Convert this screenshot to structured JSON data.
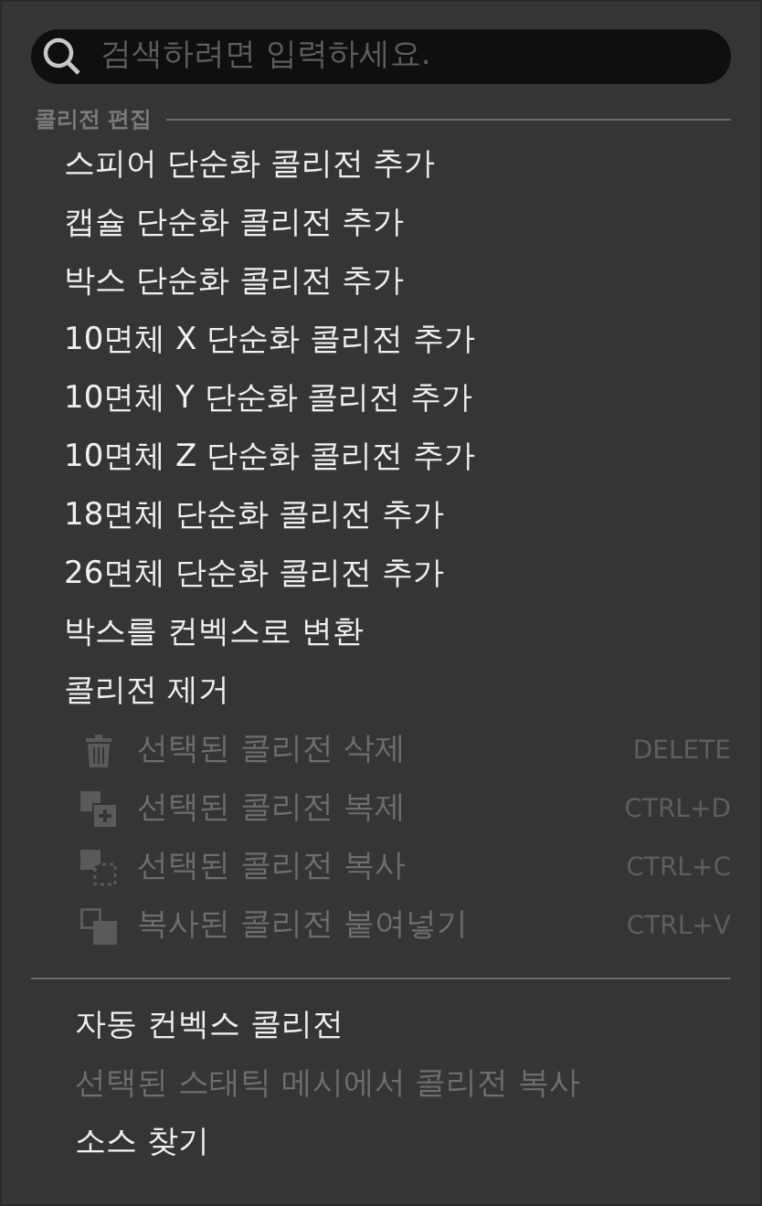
{
  "search": {
    "placeholder": "검색하려면 입력하세요."
  },
  "section": {
    "title": "콜리전 편집"
  },
  "items": [
    {
      "kind": "plain",
      "label": "스피어 단순화 콜리전 추가",
      "disabled": false
    },
    {
      "kind": "plain",
      "label": "캡슐 단순화 콜리전 추가",
      "disabled": false
    },
    {
      "kind": "plain",
      "label": "박스 단순화 콜리전 추가",
      "disabled": false
    },
    {
      "kind": "plain",
      "label": "10면체 X 단순화 콜리전 추가",
      "disabled": false
    },
    {
      "kind": "plain",
      "label": "10면체 Y 단순화 콜리전 추가",
      "disabled": false
    },
    {
      "kind": "plain",
      "label": "10면체 Z 단순화 콜리전 추가",
      "disabled": false
    },
    {
      "kind": "plain",
      "label": "18면체 단순화 콜리전 추가",
      "disabled": false
    },
    {
      "kind": "plain",
      "label": "26면체 단순화 콜리전 추가",
      "disabled": false
    },
    {
      "kind": "plain",
      "label": "박스를 컨벡스로 변환",
      "disabled": false
    },
    {
      "kind": "plain",
      "label": "콜리전 제거",
      "disabled": false
    },
    {
      "kind": "delete",
      "label": "선택된 콜리전 삭제",
      "shortcut": "DELETE",
      "disabled": true
    },
    {
      "kind": "duplicate",
      "label": "선택된 콜리전 복제",
      "shortcut": "CTRL+D",
      "disabled": true
    },
    {
      "kind": "copy",
      "label": "선택된 콜리전 복사",
      "shortcut": "CTRL+C",
      "disabled": true
    },
    {
      "kind": "paste",
      "label": "복사된 콜리전 붙여넣기",
      "shortcut": "CTRL+V",
      "disabled": true
    }
  ],
  "footer_items": [
    {
      "label": "자동 컨벡스 콜리전",
      "disabled": false
    },
    {
      "label": "선택된 스태틱 메시에서 콜리전 복사",
      "disabled": true
    },
    {
      "label": "소스 찾기",
      "disabled": false
    }
  ]
}
